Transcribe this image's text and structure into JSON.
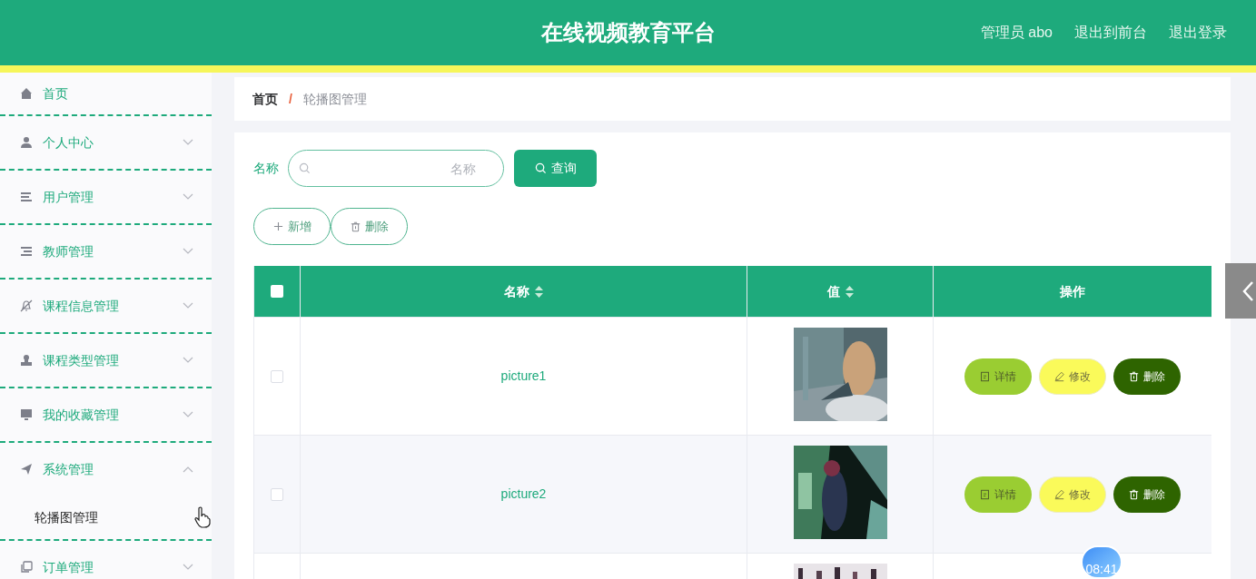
{
  "header": {
    "title": "在线视频教育平台",
    "user": "管理员 abo",
    "links": [
      "退出到前台",
      "退出登录"
    ]
  },
  "sidebar": {
    "items": [
      {
        "label": "首页",
        "kind": "link"
      },
      {
        "label": "个人中心",
        "kind": "menu",
        "expanded": false
      },
      {
        "label": "用户管理",
        "kind": "menu",
        "expanded": false
      },
      {
        "label": "教师管理",
        "kind": "menu",
        "expanded": false
      },
      {
        "label": "课程信息管理",
        "kind": "menu",
        "expanded": false
      },
      {
        "label": "课程类型管理",
        "kind": "menu",
        "expanded": false
      },
      {
        "label": "我的收藏管理",
        "kind": "menu",
        "expanded": false
      },
      {
        "label": "系统管理",
        "kind": "menu",
        "expanded": true,
        "children": [
          {
            "label": "轮播图管理",
            "selected": true
          }
        ]
      },
      {
        "label": "订单管理",
        "kind": "menu",
        "expanded": false
      }
    ]
  },
  "breadcrumb": [
    "首页",
    "/",
    "轮播图管理"
  ],
  "search": {
    "label": "名称",
    "placeholder": "名称",
    "button": "查询"
  },
  "actions": [
    {
      "kind": "add",
      "label": "新增"
    },
    {
      "kind": "delete",
      "label": "删除"
    }
  ],
  "table": {
    "select_all": {
      "checked": false
    },
    "columns": [
      {
        "label": "名称",
        "sortable": true
      },
      {
        "label": "值",
        "sortable": true
      },
      {
        "label": "操作",
        "sortable": false
      }
    ],
    "rows": [
      {
        "checked": false,
        "name": "picture1",
        "value": {
          "kind": "picture"
        },
        "buttons": [
          {
            "kind": "detail",
            "label": "详情"
          },
          {
            "kind": "edit",
            "label": "修改"
          },
          {
            "kind": "delete",
            "label": "删除"
          }
        ]
      },
      {
        "checked": false,
        "name": "picture2",
        "value": {
          "kind": "picture"
        },
        "buttons": [
          {
            "kind": "detail",
            "label": "详情"
          },
          {
            "kind": "edit",
            "label": "修改"
          },
          {
            "kind": "delete",
            "label": "删除"
          }
        ]
      },
      {
        "value": {
          "kind": "picture"
        }
      }
    ]
  },
  "overlay": {
    "time": "08:41"
  }
}
